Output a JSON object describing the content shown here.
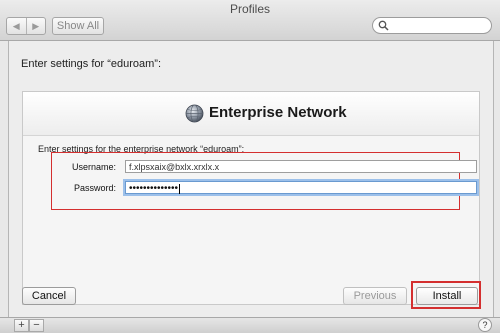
{
  "window": {
    "title": "Profiles"
  },
  "toolbar": {
    "back_icon": "◀",
    "forward_icon": "▶",
    "show_all_label": "Show All",
    "search_placeholder": ""
  },
  "sheet": {
    "prompt": "Enter settings for “eduroam”:",
    "panel": {
      "title": "Enterprise Network",
      "description": "Enter settings for the enterprise network “eduroam”:",
      "username_label": "Username:",
      "username_value": "f.xlpsxaix@bxlx.xrxlx.x",
      "password_label": "Password:",
      "password_value": "••••••••••••••"
    },
    "buttons": {
      "cancel": "Cancel",
      "previous": "Previous",
      "install": "Install"
    }
  },
  "footer": {
    "add": "+",
    "remove": "−",
    "help": "?"
  },
  "colors": {
    "highlight": "#d42f2f",
    "focus_ring": "#9cc0ea"
  }
}
